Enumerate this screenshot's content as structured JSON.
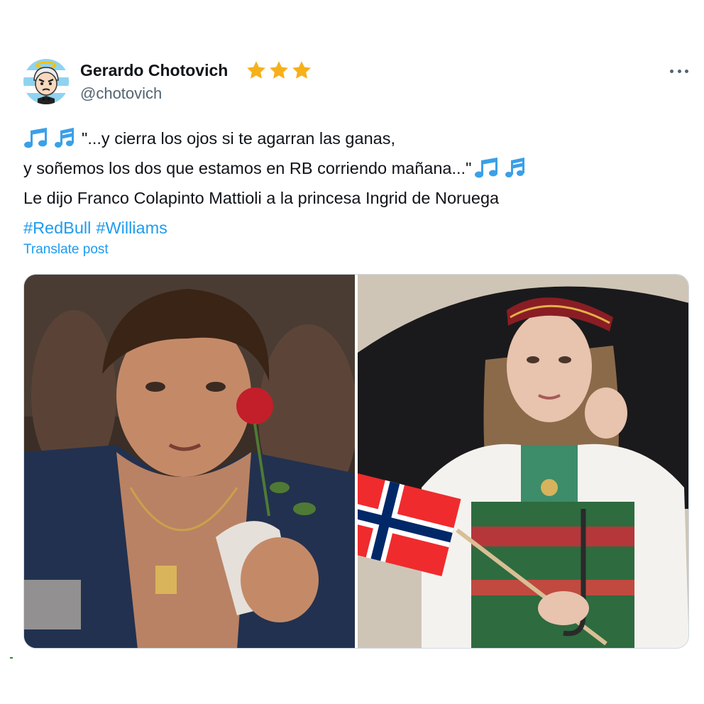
{
  "author": {
    "name": "Gerardo Chotovich",
    "handle": "@chotovich",
    "badge_icon": "star-icon",
    "badge_count": 3,
    "badge_color": "#f6b01a",
    "avatar_icon": "cartoon-angel-avatar"
  },
  "more_menu_icon": "more-horizontal-icon",
  "tweet": {
    "line1": "\"...y cierra los ojos si te agarran las ganas,",
    "line2": "y soñemos los dos que estamos en RB corriendo mañana...\"",
    "line3": "Le dijo Franco Colapinto Mattioli a la princesa Ingrid de Noruega",
    "hashtags": [
      "#RedBull",
      "#Williams"
    ],
    "emoji": "musical-notes-emoji"
  },
  "translate_label": "Translate post",
  "colors": {
    "link": "#1d9bf0",
    "text": "#0f1419",
    "secondary": "#536471"
  },
  "media": {
    "left_photo": "young-man-holding-rose-photo",
    "right_photo": "woman-with-norwegian-flag-photo"
  }
}
